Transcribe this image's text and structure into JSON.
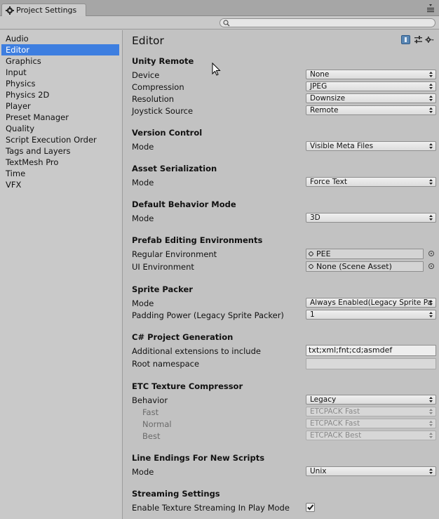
{
  "window": {
    "tab_title": "Project Settings",
    "menu_icon": "window-menu-icon"
  },
  "search": {
    "placeholder": "",
    "icon": "search-icon"
  },
  "sidebar": {
    "items": [
      {
        "label": "Audio"
      },
      {
        "label": "Editor",
        "selected": true
      },
      {
        "label": "Graphics"
      },
      {
        "label": "Input"
      },
      {
        "label": "Physics"
      },
      {
        "label": "Physics 2D"
      },
      {
        "label": "Player"
      },
      {
        "label": "Preset Manager"
      },
      {
        "label": "Quality"
      },
      {
        "label": "Script Execution Order"
      },
      {
        "label": "Tags and Layers"
      },
      {
        "label": "TextMesh Pro"
      },
      {
        "label": "Time"
      },
      {
        "label": "VFX"
      }
    ]
  },
  "main": {
    "title": "Editor",
    "unity_remote": {
      "header": "Unity Remote",
      "device": {
        "label": "Device",
        "value": "None"
      },
      "compression": {
        "label": "Compression",
        "value": "JPEG"
      },
      "resolution": {
        "label": "Resolution",
        "value": "Downsize"
      },
      "joystick": {
        "label": "Joystick Source",
        "value": "Remote"
      }
    },
    "version_control": {
      "header": "Version Control",
      "mode": {
        "label": "Mode",
        "value": "Visible Meta Files"
      }
    },
    "asset_serialization": {
      "header": "Asset Serialization",
      "mode": {
        "label": "Mode",
        "value": "Force Text"
      }
    },
    "default_behavior": {
      "header": "Default Behavior Mode",
      "mode": {
        "label": "Mode",
        "value": "3D"
      }
    },
    "prefab_env": {
      "header": "Prefab Editing Environments",
      "regular": {
        "label": "Regular Environment",
        "value": "PEE"
      },
      "ui": {
        "label": "UI Environment",
        "value": "None (Scene Asset)"
      }
    },
    "sprite_packer": {
      "header": "Sprite Packer",
      "mode": {
        "label": "Mode",
        "value": "Always Enabled(Legacy Sprite Pa"
      },
      "padding": {
        "label": "Padding Power (Legacy Sprite Packer)",
        "value": "1"
      }
    },
    "csharp_gen": {
      "header": "C# Project Generation",
      "extensions": {
        "label": "Additional extensions to include",
        "value": "txt;xml;fnt;cd;asmdef"
      },
      "root_ns": {
        "label": "Root namespace",
        "value": ""
      }
    },
    "etc": {
      "header": "ETC Texture Compressor",
      "behavior": {
        "label": "Behavior",
        "value": "Legacy"
      },
      "fast": {
        "label": "Fast",
        "value": "ETCPACK Fast"
      },
      "normal": {
        "label": "Normal",
        "value": "ETCPACK Fast"
      },
      "best": {
        "label": "Best",
        "value": "ETCPACK Best"
      }
    },
    "line_endings": {
      "header": "Line Endings For New Scripts",
      "mode": {
        "label": "Mode",
        "value": "Unix"
      }
    },
    "streaming": {
      "header": "Streaming Settings",
      "enable": {
        "label": "Enable Texture Streaming In Play Mode",
        "checked": true
      }
    }
  },
  "colors": {
    "selection": "#3d7ee0",
    "panel_bg": "#c2c2c2",
    "sidebar_bg": "#c9c9c9"
  }
}
